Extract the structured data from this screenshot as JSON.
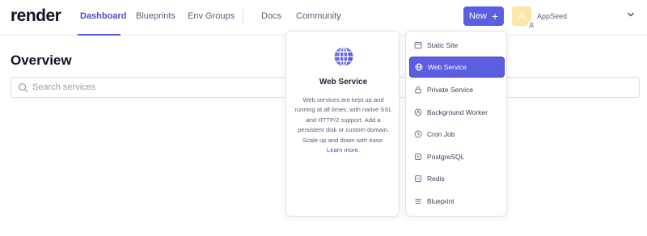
{
  "header": {
    "logo": "render",
    "nav": [
      {
        "label": "Dashboard",
        "active": true
      },
      {
        "label": "Blueprints",
        "active": false
      },
      {
        "label": "Env Groups",
        "active": false
      },
      {
        "label": "Docs",
        "active": false
      },
      {
        "label": "Community",
        "active": false
      }
    ],
    "new_button": {
      "label": "New",
      "plus": "+"
    },
    "user": {
      "avatar_letter": "A",
      "name": "AppSeed"
    }
  },
  "main": {
    "title": "Overview",
    "search": {
      "placeholder": "Search services",
      "value": ""
    }
  },
  "new_menu": {
    "description": {
      "icon": "globe-icon",
      "title": "Web Service",
      "body": "Web services are kept up and running at all times, with native SSL and HTTP/2 support. Add a persistent disk or custom domain. Scale up and down with ease.",
      "link": "Learn more."
    },
    "items": [
      {
        "label": "Static Site",
        "icon": "static-site-icon"
      },
      {
        "label": "Web Service",
        "icon": "globe-icon",
        "selected": true
      },
      {
        "label": "Private Service",
        "icon": "lock-icon"
      },
      {
        "label": "Background Worker",
        "icon": "worker-icon"
      },
      {
        "label": "Cron Job",
        "icon": "clock-icon"
      },
      {
        "label": "PostgreSQL",
        "icon": "database-icon"
      },
      {
        "label": "Redis",
        "icon": "redis-icon"
      },
      {
        "label": "Blueprint",
        "icon": "blueprint-icon"
      }
    ]
  },
  "colors": {
    "accent": "#5b5ee0",
    "nav_active": "#4c4fc4",
    "text": "#1f2433",
    "muted": "#5a5f7a",
    "avatar_bg": "#fde6a8"
  }
}
